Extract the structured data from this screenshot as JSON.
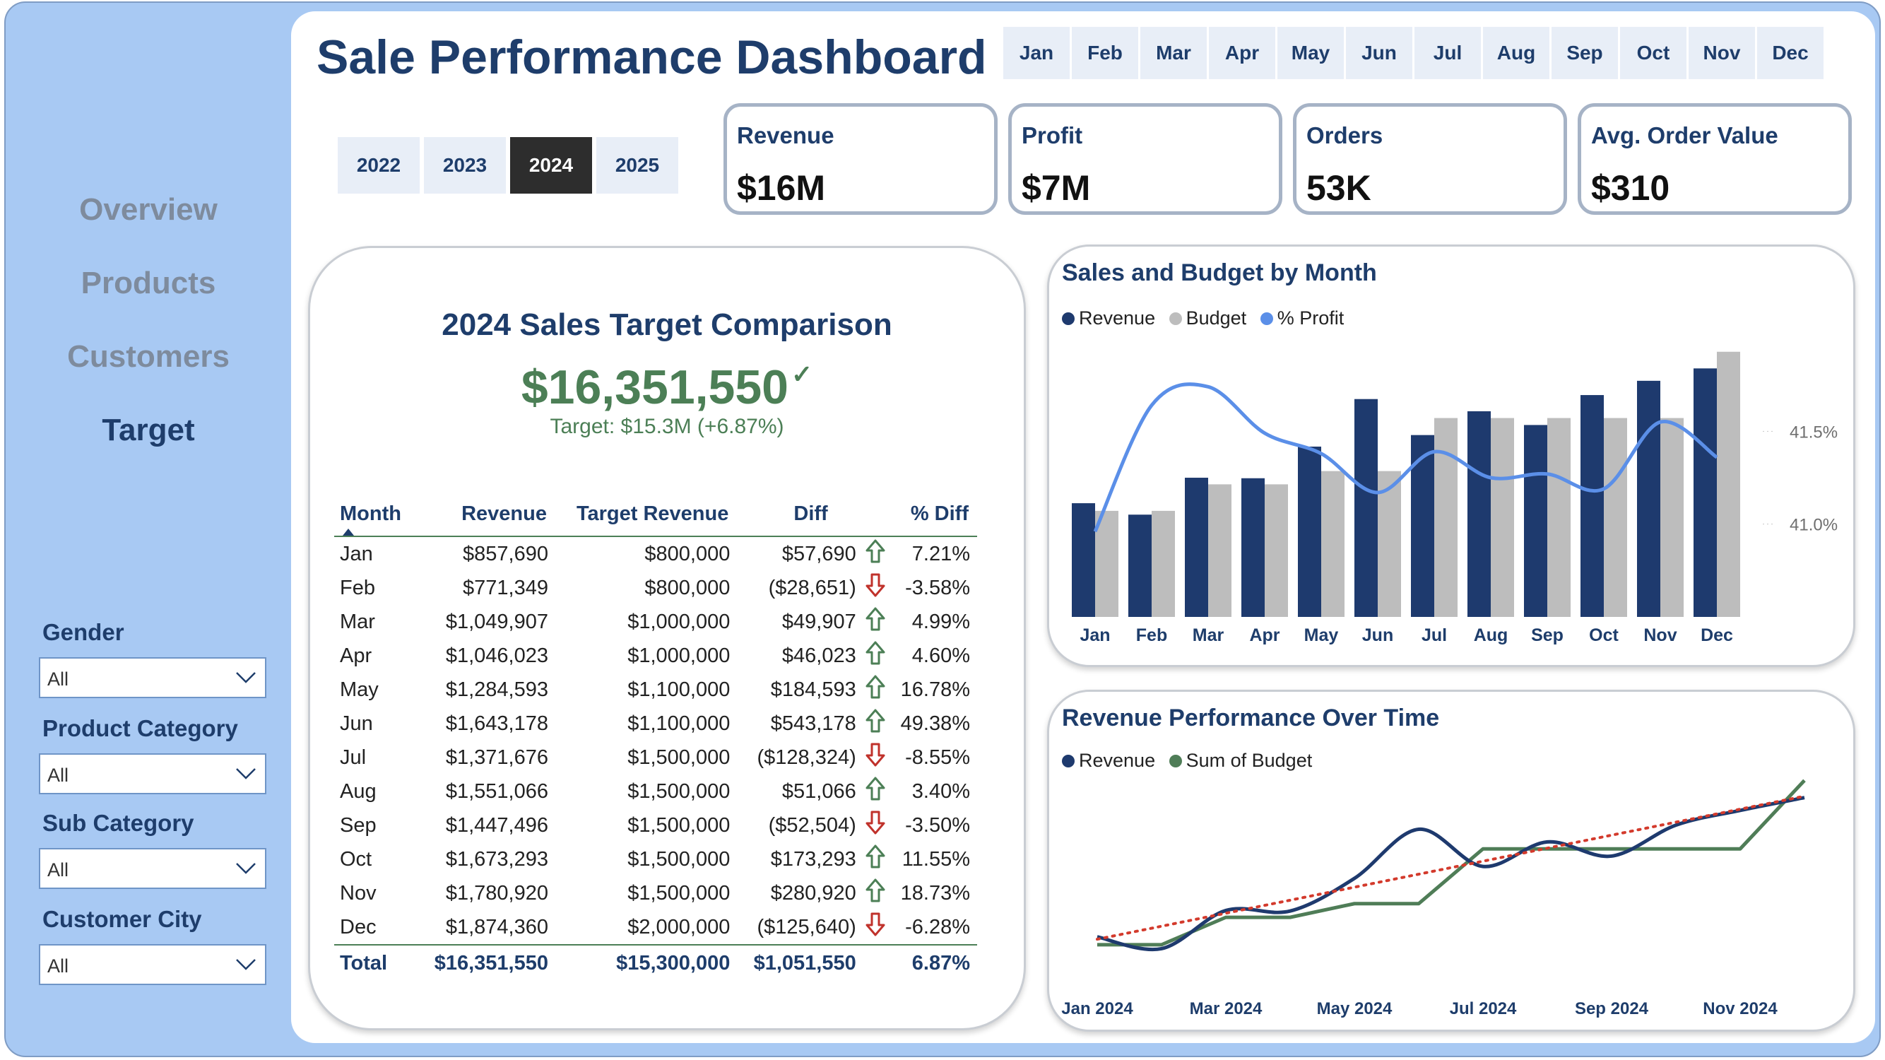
{
  "title": "Sale Performance Dashboard",
  "nav": [
    "Overview",
    "Products",
    "Customers",
    "Target"
  ],
  "nav_active": "Target",
  "filters": [
    {
      "label": "Gender",
      "value": "All"
    },
    {
      "label": "Product Category",
      "value": "All"
    },
    {
      "label": "Sub Category",
      "value": "All"
    },
    {
      "label": "Customer City",
      "value": "All"
    }
  ],
  "months": [
    "Jan",
    "Feb",
    "Mar",
    "Apr",
    "May",
    "Jun",
    "Jul",
    "Aug",
    "Sep",
    "Oct",
    "Nov",
    "Dec"
  ],
  "years": [
    "2022",
    "2023",
    "2024",
    "2025"
  ],
  "year_selected": "2024",
  "kpis": [
    {
      "label": "Revenue",
      "value": "$16M"
    },
    {
      "label": "Profit",
      "value": "$7M"
    },
    {
      "label": "Orders",
      "value": "53K"
    },
    {
      "label": "Avg. Order Value",
      "value": "$310"
    }
  ],
  "target_card": {
    "title": "2024 Sales Target Comparison",
    "amount": "$16,351,550",
    "check": "✓",
    "target_text": "Target: $15.3M (+6.87%)",
    "columns": [
      "Month",
      "Revenue",
      "Target Revenue",
      "Diff",
      "% Diff"
    ],
    "rows": [
      {
        "month": "Jan",
        "revenue": "$857,690",
        "target": "$800,000",
        "diff": "$57,690",
        "trend": "up",
        "pct": "7.21%"
      },
      {
        "month": "Feb",
        "revenue": "$771,349",
        "target": "$800,000",
        "diff": "($28,651)",
        "trend": "down",
        "pct": "-3.58%"
      },
      {
        "month": "Mar",
        "revenue": "$1,049,907",
        "target": "$1,000,000",
        "diff": "$49,907",
        "trend": "up",
        "pct": "4.99%"
      },
      {
        "month": "Apr",
        "revenue": "$1,046,023",
        "target": "$1,000,000",
        "diff": "$46,023",
        "trend": "up",
        "pct": "4.60%"
      },
      {
        "month": "May",
        "revenue": "$1,284,593",
        "target": "$1,100,000",
        "diff": "$184,593",
        "trend": "up",
        "pct": "16.78%"
      },
      {
        "month": "Jun",
        "revenue": "$1,643,178",
        "target": "$1,100,000",
        "diff": "$543,178",
        "trend": "up",
        "pct": "49.38%"
      },
      {
        "month": "Jul",
        "revenue": "$1,371,676",
        "target": "$1,500,000",
        "diff": "($128,324)",
        "trend": "down",
        "pct": "-8.55%"
      },
      {
        "month": "Aug",
        "revenue": "$1,551,066",
        "target": "$1,500,000",
        "diff": "$51,066",
        "trend": "up",
        "pct": "3.40%"
      },
      {
        "month": "Sep",
        "revenue": "$1,447,496",
        "target": "$1,500,000",
        "diff": "($52,504)",
        "trend": "down",
        "pct": "-3.50%"
      },
      {
        "month": "Oct",
        "revenue": "$1,673,293",
        "target": "$1,500,000",
        "diff": "$173,293",
        "trend": "up",
        "pct": "11.55%"
      },
      {
        "month": "Nov",
        "revenue": "$1,780,920",
        "target": "$1,500,000",
        "diff": "$280,920",
        "trend": "up",
        "pct": "18.73%"
      },
      {
        "month": "Dec",
        "revenue": "$1,874,360",
        "target": "$2,000,000",
        "diff": "($125,640)",
        "trend": "down",
        "pct": "-6.28%"
      }
    ],
    "total": {
      "label": "Total",
      "revenue": "$16,351,550",
      "target": "$15,300,000",
      "diff": "$1,051,550",
      "pct": "6.87%"
    }
  },
  "colors": {
    "revenue": "#1e3a6e",
    "budget": "#bdbdbd",
    "profit": "#5b8fe8",
    "sum_budget": "#4f7d57",
    "trend": "#d33a2c",
    "positive": "#4c7f56",
    "negative": "#c0322b"
  },
  "chart_data": [
    {
      "type": "bar",
      "title": "Sales and Budget by Month",
      "categories": [
        "Jan",
        "Feb",
        "Mar",
        "Apr",
        "May",
        "Jun",
        "Jul",
        "Aug",
        "Sep",
        "Oct",
        "Nov",
        "Dec"
      ],
      "series": [
        {
          "name": "Revenue",
          "type": "bar",
          "values": [
            857690,
            771349,
            1049907,
            1046023,
            1284593,
            1643178,
            1371676,
            1551066,
            1447496,
            1673293,
            1780920,
            1874360
          ]
        },
        {
          "name": "Budget",
          "type": "bar",
          "values": [
            800000,
            800000,
            1000000,
            1000000,
            1100000,
            1100000,
            1500000,
            1500000,
            1500000,
            1500000,
            1500000,
            2000000
          ]
        },
        {
          "name": "% Profit",
          "type": "line",
          "axis": "right",
          "values": [
            40.96,
            41.64,
            41.74,
            41.49,
            41.38,
            41.17,
            41.39,
            41.25,
            41.27,
            41.19,
            41.55,
            41.36
          ]
        }
      ],
      "ylim": [
        0,
        2100000
      ],
      "y2ticks": [
        "41.0%",
        "41.5%"
      ],
      "y2ticks_values": [
        41.0,
        41.5
      ],
      "y2lim": [
        40.5,
        42.0
      ],
      "legend": "top-left"
    },
    {
      "type": "line",
      "title": "Revenue Performance Over Time",
      "x": [
        "Jan 2024",
        "Feb 2024",
        "Mar 2024",
        "Apr 2024",
        "May 2024",
        "Jun 2024",
        "Jul 2024",
        "Aug 2024",
        "Sep 2024",
        "Oct 2024",
        "Nov 2024",
        "Dec 2024"
      ],
      "xticks": [
        "Jan 2024",
        "Mar 2024",
        "May 2024",
        "Jul 2024",
        "Sep 2024",
        "Nov 2024"
      ],
      "series": [
        {
          "name": "Revenue",
          "values": [
            857690,
            771349,
            1049907,
            1046023,
            1284593,
            1643178,
            1371676,
            1551066,
            1447496,
            1673293,
            1780920,
            1874360
          ]
        },
        {
          "name": "Sum of Budget",
          "values": [
            800000,
            800000,
            1000000,
            1000000,
            1100000,
            1100000,
            1500000,
            1500000,
            1500000,
            1500000,
            1500000,
            2000000
          ]
        }
      ],
      "trendline": "dotted linear trend of Revenue",
      "ylim": [
        500000,
        2100000
      ],
      "legend": "top-left"
    }
  ]
}
